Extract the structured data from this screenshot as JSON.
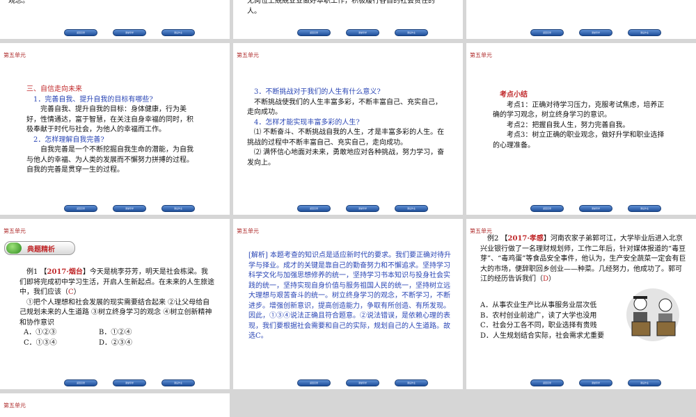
{
  "unit_label": "第五单元",
  "nav": {
    "btn_left": "返回目录",
    "btn_mid": "课堂导学",
    "btn_right": "课后作业"
  },
  "s1": {
    "text": "观念。"
  },
  "s2": {
    "l1": "无岗位上兢兢业业做好本职工作，积极履行各自的社会责任的",
    "l2": "人。"
  },
  "s4": {
    "heading": "三、自信走向未来",
    "q1": "1．完善自我、提升自我的目标有哪些?",
    "a1": "完善自我、提升自我的目标：身体健康，行为美好，性情通达，富于智慧，在关注自身幸福的同时，积极奉献于时代与社会，为他人的幸福而工作。",
    "q2": "2．怎样理解自我完善?",
    "a2": "自我完善是一个不断挖掘自我生命的潜能，为自我与他人的幸福、为人类的发展而不懈努力拼搏的过程。自我的完善是贯穿一生的过程。"
  },
  "s5": {
    "q3": "3．不断挑战对于我们的人生有什么意义?",
    "a3": "不断挑战使我们的人生丰富多彩，不断丰富自己、充实自己，走向成功。",
    "q4": "4．怎样才能实现丰富多彩的人生?",
    "a4a": "⑴ 不断奋斗、不断挑战自我的人生，才是丰富多彩的人生。在挑战的过程中不断丰富自己、充实自己，走向成功。",
    "a4b": "⑵ 满怀信心地面对未来，勇敢地应对各种挑战，努力学习，奋发向上。"
  },
  "s6": {
    "title": "考点小结",
    "p1": "考点1：正确对待学习压力，克服考试焦虑，培养正确的学习观念，树立终身学习的意识。",
    "p2": "考点2：把握自我人生，努力完善自我。",
    "p3": "考点3：树立正确的职业观念，做好升学和职业选择的心理准备。"
  },
  "s7": {
    "tag": "典题精析",
    "ex_prefix": "例1 【",
    "ex_source": "2017·烟台",
    "ex_text": "】今天是桃李芬芳，明天是社会栋梁。我们即将完成初中学习生活，开启人生新起点。在未来的人生旅途中，我们应该（",
    "answer": "C",
    "ex_end": "）",
    "opt1": "①把个人理想和社会发展的现实需要结合起来 ②让父母给自己规划未来的人生道路 ③树立终身学习的观念 ④树立创新精神和协作意识",
    "optA": "A．①②③",
    "optB": "B．①②④",
    "optC": "C．①③④",
    "optD": "D．②③④"
  },
  "s8": {
    "text": "[解析] 本题考查的知识点是适应新时代的要求。我们要正确对待升学与择业。成才的关键是靠自己的勤奋努力和不懈追求。坚持学习科学文化与加强思想修养的统一，坚持学习书本知识与投身社会实践的统一，坚持实现自身价值与服务祖国人民的统一，坚持树立远大理想与艰苦奋斗的统一。树立终身学习的观念，不断学习，不断进步。增强创新意识，提高创造能力，争取有所创造、有所发现。因此，①③④说法正确且符合题意。②说法错误，是依赖心理的表现，我们要根据社会需要和自己的实际，规划自己的人生道路。故选C。"
  },
  "s9": {
    "ex_prefix": "例2 【",
    "ex_source": "2017·孝感",
    "ex_text": "】河南农家子弟郭可江，大学毕业后进入北京兴业银行做了一名理财规划师，工作二年后，针对媒体报道的“毒豆芽”、“毒鸡蛋”等食品安全事件，他认为，生产安全蔬菜一定会有巨大的市场，便辞职回乡创业——种菜。几经努力，他成功了。郭可江的经历告诉我们（",
    "answer": "D",
    "ex_end": "）",
    "optA": "A．从事农业生产比从事服务业层次低",
    "optB": "B．农村创业前途广，读了大学也没用",
    "optC": "C．社会分工各不同，职业选择有贵贱",
    "optD": "D．人生规划结合实际，社会需求尤重要"
  }
}
